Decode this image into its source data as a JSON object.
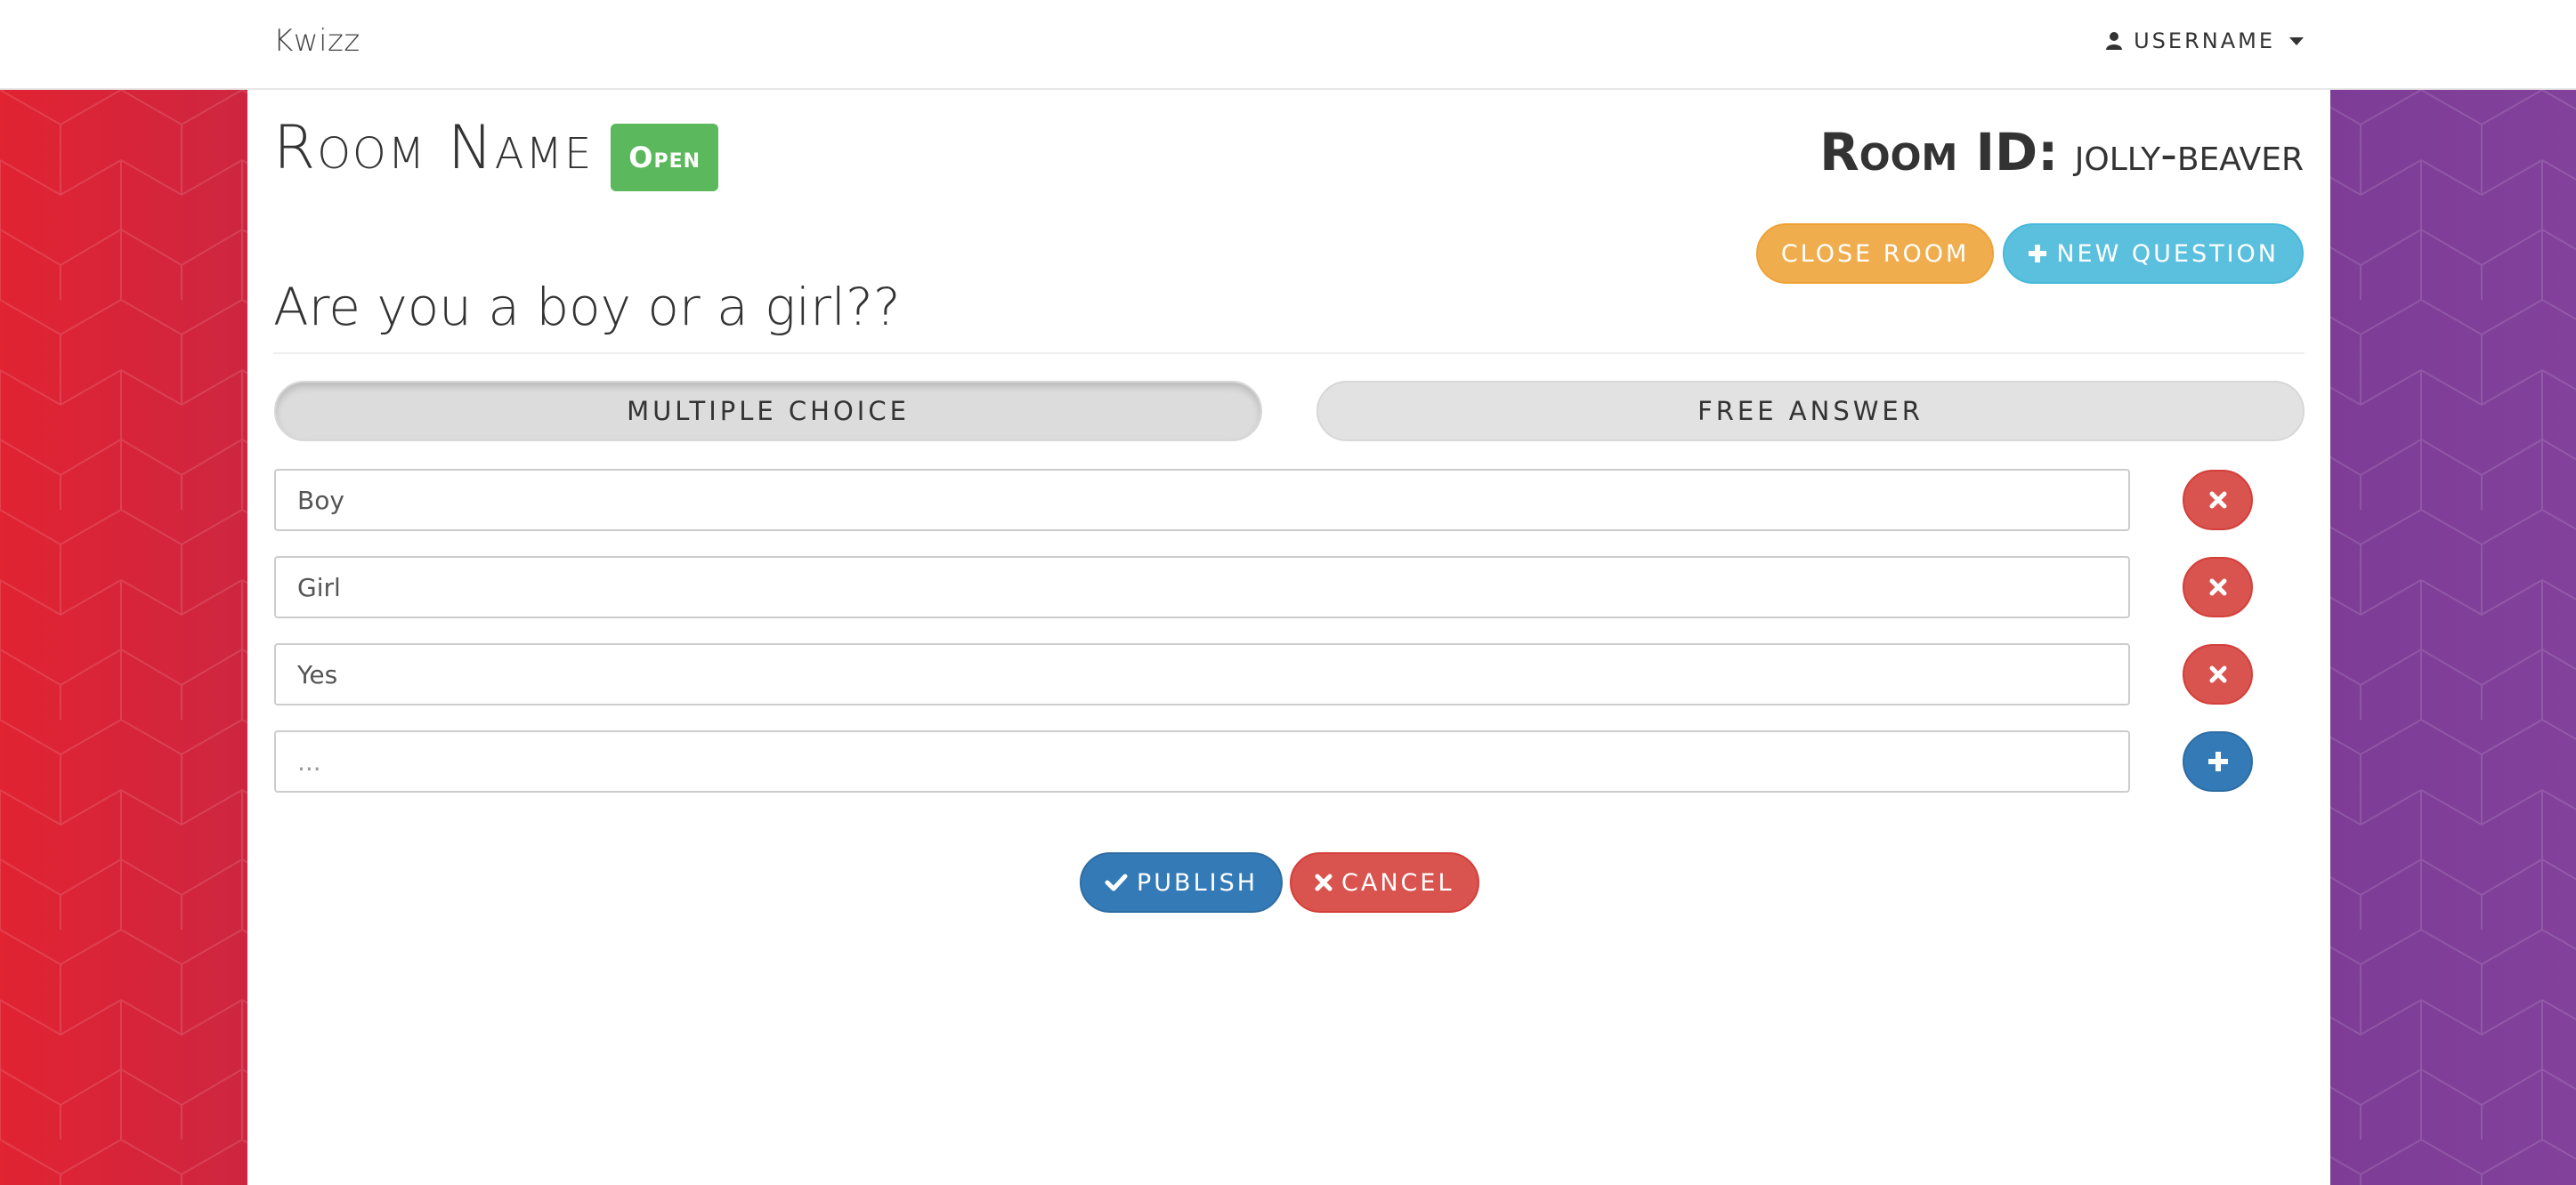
{
  "navbar": {
    "brand": "Kwizz",
    "username": "USERNAME",
    "user_icon": "user-icon",
    "caret_icon": "caret-down-icon"
  },
  "room": {
    "name": "Room Name",
    "status": "Open",
    "id_label": "Room ID:",
    "id_value": "jolly-beaver"
  },
  "actions": {
    "close_room": "CLOSE ROOM",
    "new_question": "NEW QUESTION"
  },
  "question": {
    "text": "Are you a boy or a girl??",
    "type_options": [
      "MULTIPLE CHOICE",
      "FREE ANSWER"
    ],
    "selected_type": "MULTIPLE CHOICE"
  },
  "answers": [
    {
      "value": "Boy",
      "placeholder": ""
    },
    {
      "value": "Girl",
      "placeholder": ""
    },
    {
      "value": "Yes",
      "placeholder": ""
    }
  ],
  "new_answer": {
    "value": "",
    "placeholder": "..."
  },
  "footer": {
    "publish": "PUBLISH",
    "cancel": "CANCEL"
  },
  "colors": {
    "open_badge": "#5cb85c",
    "close_room": "#f0ad4e",
    "new_question": "#5bc0de",
    "remove": "#d9534f",
    "add": "#337ab7",
    "publish": "#337ab7",
    "cancel": "#d9534f"
  }
}
